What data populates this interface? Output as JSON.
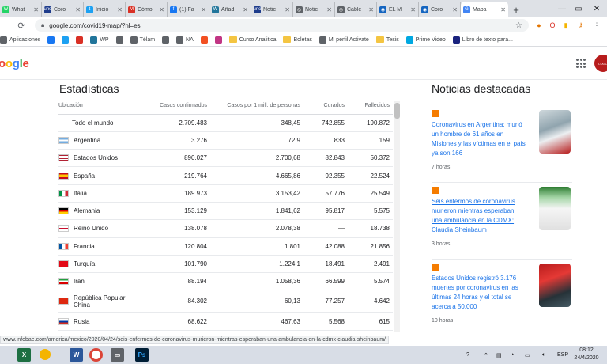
{
  "tabs": [
    {
      "title": "What",
      "fav": "W",
      "color": "#25d366"
    },
    {
      "title": "Coro",
      "fav": "uno",
      "color": "#1e3c8c"
    },
    {
      "title": "Inicio",
      "fav": "t",
      "color": "#1da1f2"
    },
    {
      "title": "Cómo",
      "fav": "M",
      "color": "#d93025"
    },
    {
      "title": "(1) Fa",
      "fav": "f",
      "color": "#1877f2"
    },
    {
      "title": "Añad",
      "fav": "W",
      "color": "#21759b"
    },
    {
      "title": "Notic",
      "fav": "uno",
      "color": "#1e3c8c"
    },
    {
      "title": "Notic",
      "fav": "◎",
      "color": "#5f6368"
    },
    {
      "title": "Cable",
      "fav": "◎",
      "color": "#5f6368"
    },
    {
      "title": "EL M",
      "fav": "◉",
      "color": "#1565c0"
    },
    {
      "title": "Coro",
      "fav": "◉",
      "color": "#1565c0"
    },
    {
      "title": "Mapa",
      "fav": "G",
      "color": "#4285f4",
      "active": true
    }
  ],
  "url": "google.com/covid19-map/?hl=es",
  "bookmarks": [
    {
      "label": "Aplicaciones",
      "icon": "apps-icon",
      "color": "#5f6368"
    },
    {
      "label": "",
      "icon": "facebook-icon",
      "color": "#1877f2"
    },
    {
      "label": "",
      "icon": "twitter-icon",
      "color": "#1da1f2"
    },
    {
      "label": "",
      "icon": "gmail-icon",
      "color": "#d93025"
    },
    {
      "label": "WP",
      "icon": "wordpress-icon",
      "color": "#21759b"
    },
    {
      "label": "",
      "icon": "web-icon",
      "color": "#5f6368"
    },
    {
      "label": "Télam",
      "icon": "telam-icon",
      "color": "#5f6368"
    },
    {
      "label": "",
      "icon": "web-icon",
      "color": "#5f6368"
    },
    {
      "label": "NA",
      "icon": "na-icon",
      "color": "#5f6368"
    },
    {
      "label": "",
      "icon": "office-icon",
      "color": "#f25022"
    },
    {
      "label": "",
      "icon": "instagram-icon",
      "color": "#c13584"
    },
    {
      "label": "Curso Analitica",
      "icon": "folder-icon",
      "color": "#f4c542"
    },
    {
      "label": "Boletas",
      "icon": "folder-icon",
      "color": "#f4c542"
    },
    {
      "label": "Mi perfil Activate",
      "icon": "web-icon",
      "color": "#5f6368"
    },
    {
      "label": "Tesis",
      "icon": "folder-icon",
      "color": "#f4c542"
    },
    {
      "label": "Prime Video",
      "icon": "prime-icon",
      "color": "#00a8e1"
    },
    {
      "label": "Libro de texto para...",
      "icon": "book-icon",
      "color": "#1a237e"
    }
  ],
  "logo_text": "oogle",
  "stats": {
    "title": "Estadísticas",
    "headers": [
      "Ubicación",
      "Casos confirmados",
      "Casos por 1 mill. de personas",
      "Curados",
      "Fallecidos"
    ],
    "rows": [
      {
        "loc": "Todo el mundo",
        "flag": "none",
        "confirmed": "2.709.483",
        "per_million": "348,45",
        "recovered": "742.855",
        "deaths": "190.872"
      },
      {
        "loc": "Argentina",
        "flag": "ar",
        "confirmed": "3.276",
        "per_million": "72,9",
        "recovered": "833",
        "deaths": "159"
      },
      {
        "loc": "Estados Unidos",
        "flag": "us",
        "confirmed": "890.027",
        "per_million": "2.700,68",
        "recovered": "82.843",
        "deaths": "50.372"
      },
      {
        "loc": "España",
        "flag": "es",
        "confirmed": "219.764",
        "per_million": "4.665,86",
        "recovered": "92.355",
        "deaths": "22.524"
      },
      {
        "loc": "Italia",
        "flag": "it",
        "confirmed": "189.973",
        "per_million": "3.153,42",
        "recovered": "57.776",
        "deaths": "25.549"
      },
      {
        "loc": "Alemania",
        "flag": "de",
        "confirmed": "153.129",
        "per_million": "1.841,62",
        "recovered": "95.817",
        "deaths": "5.575"
      },
      {
        "loc": "Reino Unido",
        "flag": "gb",
        "confirmed": "138.078",
        "per_million": "2.078,38",
        "recovered": "—",
        "deaths": "18.738"
      },
      {
        "loc": "Francia",
        "flag": "fr",
        "confirmed": "120.804",
        "per_million": "1.801",
        "recovered": "42.088",
        "deaths": "21.856"
      },
      {
        "loc": "Turquía",
        "flag": "tr",
        "confirmed": "101.790",
        "per_million": "1.224,1",
        "recovered": "18.491",
        "deaths": "2.491"
      },
      {
        "loc": "Irán",
        "flag": "ir",
        "confirmed": "88.194",
        "per_million": "1.058,36",
        "recovered": "66.599",
        "deaths": "5.574"
      },
      {
        "loc": "República Popular China",
        "flag": "cn",
        "confirmed": "84.302",
        "per_million": "60,13",
        "recovered": "77.257",
        "deaths": "4.642"
      },
      {
        "loc": "Rusia",
        "flag": "ru",
        "confirmed": "68.622",
        "per_million": "467,63",
        "recovered": "5.568",
        "deaths": "615"
      }
    ]
  },
  "news": {
    "title": "Noticias destacadas",
    "items": [
      {
        "headline": "Coronavirus en Argentina: murió un hombre de 61 años en Misiones y las víctimas en el país ya son 166",
        "time": "7 horas",
        "underline": false
      },
      {
        "headline": "Seis enfermos de coronavirus murieron mientras esperaban una ambulancia en la CDMX: Claudia Sheinbaum",
        "time": "3 horas",
        "underline": true
      },
      {
        "headline": "Estados Unidos registró 3.176 muertes por coronavirus en las últimas 24 horas y el total se acerca a 50.000",
        "time": "10 horas",
        "underline": false
      }
    ]
  },
  "status_url": "www.infobae.com/america/mexico/2020/04/24/seis-enfermos-de-coronavirus-murieron-mientras-esperaban-una-ambulancia-en-la-cdmx-claudia-sheinbaum/",
  "taskbar": {
    "lang": "ESP",
    "time": "08:12",
    "date": "24/4/2020"
  }
}
